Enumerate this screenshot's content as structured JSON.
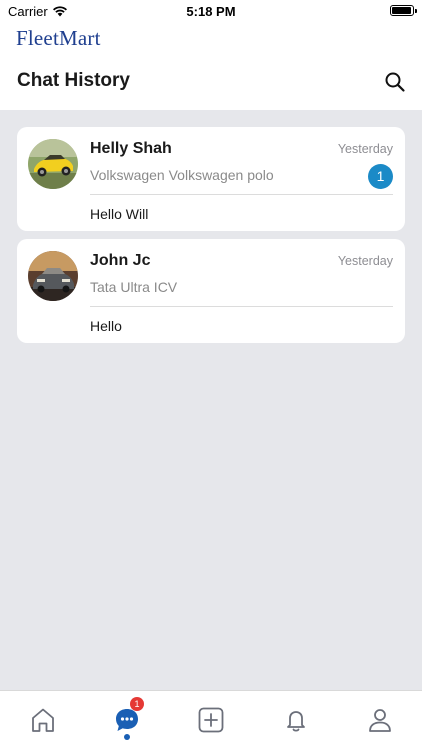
{
  "status_bar": {
    "carrier": "Carrier",
    "time": "5:18 PM"
  },
  "brand": {
    "name": "FleetMart",
    "color": "#1f3f8f"
  },
  "header": {
    "title": "Chat History",
    "search_icon": "search-icon"
  },
  "chats": [
    {
      "name": "Helly Shah",
      "vehicle": "Volkswagen Volkswagen polo",
      "time": "Yesterday",
      "unread": "1",
      "last_message": "Hello Will",
      "avatar": "yellow-sports-car-photo"
    },
    {
      "name": "John Jc",
      "vehicle": "Tata Ultra ICV",
      "time": "Yesterday",
      "unread": "",
      "last_message": "Hello",
      "avatar": "dark-sedan-photo"
    }
  ],
  "tab_bar": {
    "tabs": [
      {
        "name": "home",
        "icon": "home-icon"
      },
      {
        "name": "chat",
        "icon": "chat-bubble-icon",
        "badge": "1",
        "active": true
      },
      {
        "name": "add",
        "icon": "plus-square-icon"
      },
      {
        "name": "notifications",
        "icon": "bell-icon"
      },
      {
        "name": "profile",
        "icon": "user-icon"
      }
    ]
  },
  "colors": {
    "accent": "#1b8ac7",
    "active_tab": "#1a5fb4",
    "badge": "#e53935",
    "background": "#e6e7eb"
  }
}
